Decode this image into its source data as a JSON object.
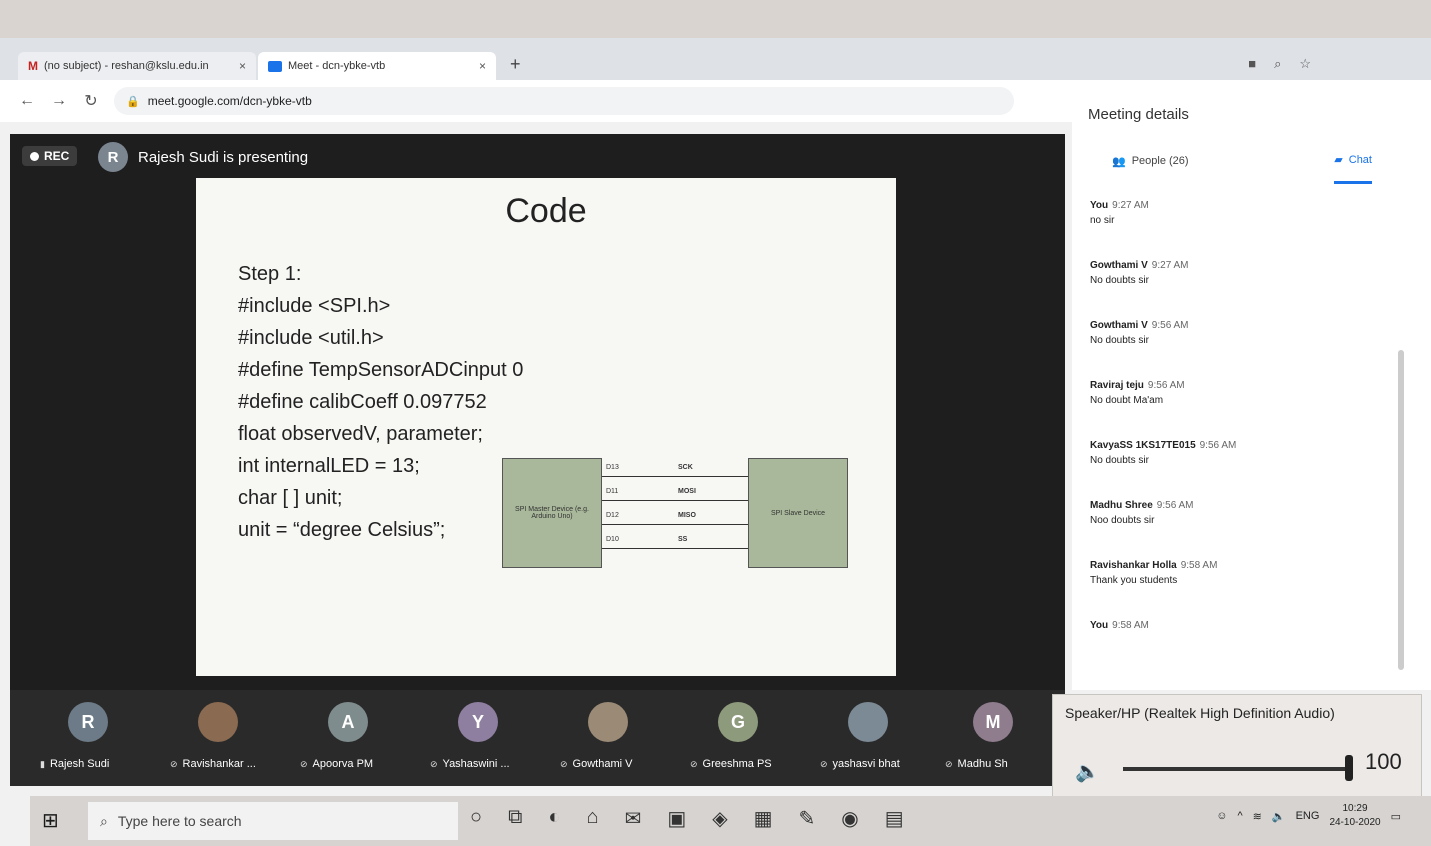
{
  "browser": {
    "tabs": [
      {
        "label": "(no subject) - reshan@kslu.edu.in",
        "icon": "gmail-icon",
        "glyph": "M"
      },
      {
        "label": "Meet - dcn-ybke-vtb",
        "icon": "meet-icon"
      }
    ],
    "new_tab": "+",
    "tab_close": "×",
    "url": "meet.google.com/dcn-ybke-vtb"
  },
  "meet": {
    "rec_label": "REC",
    "presenter_initial": "R",
    "presenter_text": "Rajesh Sudi is presenting"
  },
  "slide": {
    "title": "Code",
    "code_lines": [
      "Step 1:",
      "#include <SPI.h>",
      "#include <util.h>",
      "#define TempSensorADCinput  0",
      "#define calibCoeff  0.097752",
      "float observedV, parameter;",
      "int internalLED = 13;",
      "char [ ] unit;",
      "unit = “degree Celsius”;"
    ],
    "diagram": {
      "master_label": "SPI Master Device (e.g. Arduino Uno)",
      "slave_label": "SPI Slave Device",
      "pins": [
        "D13",
        "D11",
        "D12",
        "D10"
      ],
      "signals": [
        "SCK",
        "MOSI",
        "MISO",
        "SS"
      ]
    }
  },
  "participants": [
    {
      "initial": "R",
      "name": "Rajesh Sudi",
      "color": "#6d7b88"
    },
    {
      "initial": "",
      "name": "Ravishankar ...",
      "color": "#8a6a50"
    },
    {
      "initial": "A",
      "name": "Apoorva PM",
      "color": "#7f8c8d"
    },
    {
      "initial": "Y",
      "name": "Yashaswini ...",
      "color": "#8e7fa0"
    },
    {
      "initial": "",
      "name": "Gowthami V",
      "color": "#9a8a76"
    },
    {
      "initial": "G",
      "name": "Greeshma PS",
      "color": "#8d9a7b"
    },
    {
      "initial": "",
      "name": "yashasvi bhat",
      "color": "#7c8a96"
    },
    {
      "initial": "M",
      "name": "Madhu Sh",
      "color": "#8f7d8d"
    }
  ],
  "panel": {
    "title": "Meeting details",
    "people_tab": "People (26)",
    "chat_tab": "Chat",
    "messages": [
      {
        "name": "You",
        "time": "9:27 AM",
        "text": "no sir"
      },
      {
        "name": "Gowthami V",
        "time": "9:27 AM",
        "text": "No doubts sir"
      },
      {
        "name": "Gowthami V",
        "time": "9:56 AM",
        "text": "No doubts sir"
      },
      {
        "name": "Raviraj teju",
        "time": "9:56 AM",
        "text": "No doubt Ma'am"
      },
      {
        "name": "KavyaSS 1KS17TE015",
        "time": "9:56 AM",
        "text": "No doubts sir"
      },
      {
        "name": "Madhu Shree",
        "time": "9:56 AM",
        "text": "Noo doubts sir"
      },
      {
        "name": "Ravishankar Holla",
        "time": "9:58 AM",
        "text": "Thank you students"
      },
      {
        "name": "You",
        "time": "9:58 AM",
        "text": ""
      }
    ]
  },
  "volume": {
    "device": "Speaker/HP (Realtek High Definition Audio)",
    "level": 100
  },
  "taskbar": {
    "search_placeholder": "Type here to search",
    "lang": "ENG",
    "time": "10:29",
    "date": "24-10-2020"
  }
}
